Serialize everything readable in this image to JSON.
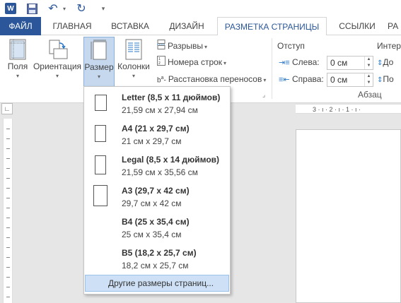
{
  "qat": {
    "logo": "W",
    "icons": [
      "word-logo-icon",
      "save-icon",
      "undo-icon",
      "redo-icon",
      "customize-qat-icon"
    ]
  },
  "tabs": [
    "ФАЙЛ",
    "ГЛАВНАЯ",
    "ВСТАВКА",
    "ДИЗАЙН",
    "РАЗМЕТКА СТРАНИЦЫ",
    "ССЫЛКИ",
    "РА"
  ],
  "active_tab": "РАЗМЕТКА СТРАНИЦЫ",
  "ribbon": {
    "margins": "Поля",
    "orientation": "Ориентация",
    "size": "Размер",
    "columns": "Колонки",
    "breaks": "Разрывы",
    "line_numbers": "Номера строк",
    "hyphenation": "Расстановка переносов",
    "indent_title": "Отступ",
    "left_label": "Слева:",
    "left_value": "0 см",
    "right_label": "Справа:",
    "right_value": "0 см",
    "spacing_title": "Интер",
    "spacing_before": "До",
    "spacing_after": "По",
    "paragraph_group": "Абзац"
  },
  "ruler": "3 · ı · 2 · ı · 1 · ı ·",
  "size_menu": {
    "items": [
      {
        "name": "Letter (8,5 x 11 дюймов)",
        "dims": "21,59 см x 27,94 см"
      },
      {
        "name": "A4 (21 x 29,7 см)",
        "dims": "21 см x 29,7 см"
      },
      {
        "name": "Legal (8,5 x 14 дюймов)",
        "dims": "21,59 см x 35,56 см"
      },
      {
        "name": "A3 (29,7 x 42 см)",
        "dims": "29,7 см x 42 см"
      },
      {
        "name": "B4 (25 x 35,4 см)",
        "dims": "25 см x 35,4 см"
      },
      {
        "name": "B5 (18,2 x 25,7 см)",
        "dims": "18,2 см x 25,7 см"
      }
    ],
    "more": "Другие размеры страниц..."
  },
  "colors": {
    "accent": "#2b579a",
    "hover": "#cde0f5",
    "pressed": "#c5d8ee"
  }
}
